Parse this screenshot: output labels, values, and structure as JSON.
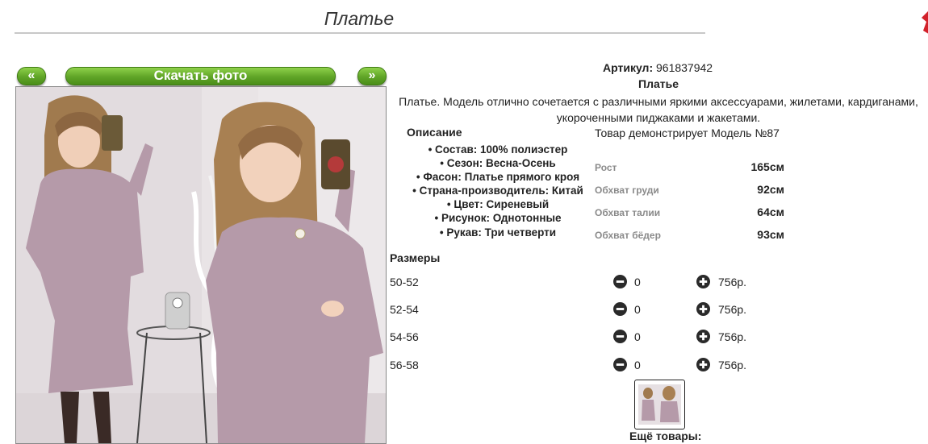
{
  "header": {
    "title": "Платье"
  },
  "gallery": {
    "prev_label": "«",
    "next_label": "»",
    "download_label": "Скачать фото"
  },
  "product": {
    "sku_label": "Артикул:",
    "sku_value": "961837942",
    "name": "Платье",
    "description": "Платье. Модель отлично сочетается с различными яркими аксессуарами, жилетами, кардиганами, укороченными пиджаками и жакетами."
  },
  "specs": {
    "heading": "Описание",
    "items": [
      "Состав: 100% полиэстер",
      "Сезон: Весна-Осень",
      "Фасон: Платье прямого кроя",
      "Страна-производитель: Китай",
      "Цвет: Сиреневый",
      "Рисунок: Однотонные",
      "Рукав: Три четверти"
    ]
  },
  "model": {
    "caption": "Товар демонстрирует Модель №87",
    "measurements": [
      {
        "label": "Рост",
        "value": "165см"
      },
      {
        "label": "Обхват груди",
        "value": "92см"
      },
      {
        "label": "Обхват талии",
        "value": "64см"
      },
      {
        "label": "Обхват бёдер",
        "value": "93см"
      }
    ]
  },
  "sizes": {
    "heading": "Размеры",
    "rows": [
      {
        "size": "50-52",
        "qty": "0",
        "price": "756р."
      },
      {
        "size": "52-54",
        "qty": "0",
        "price": "756р."
      },
      {
        "size": "54-56",
        "qty": "0",
        "price": "756р."
      },
      {
        "size": "56-58",
        "qty": "0",
        "price": "756р."
      }
    ]
  },
  "more": {
    "label": "Ещё товары:"
  },
  "colors": {
    "button_green": "#5fa427",
    "dress_lilac": "#b59aa9",
    "hair": "#a88052",
    "icon_dark": "#2a2a2a",
    "accent_red": "#d2212a"
  }
}
